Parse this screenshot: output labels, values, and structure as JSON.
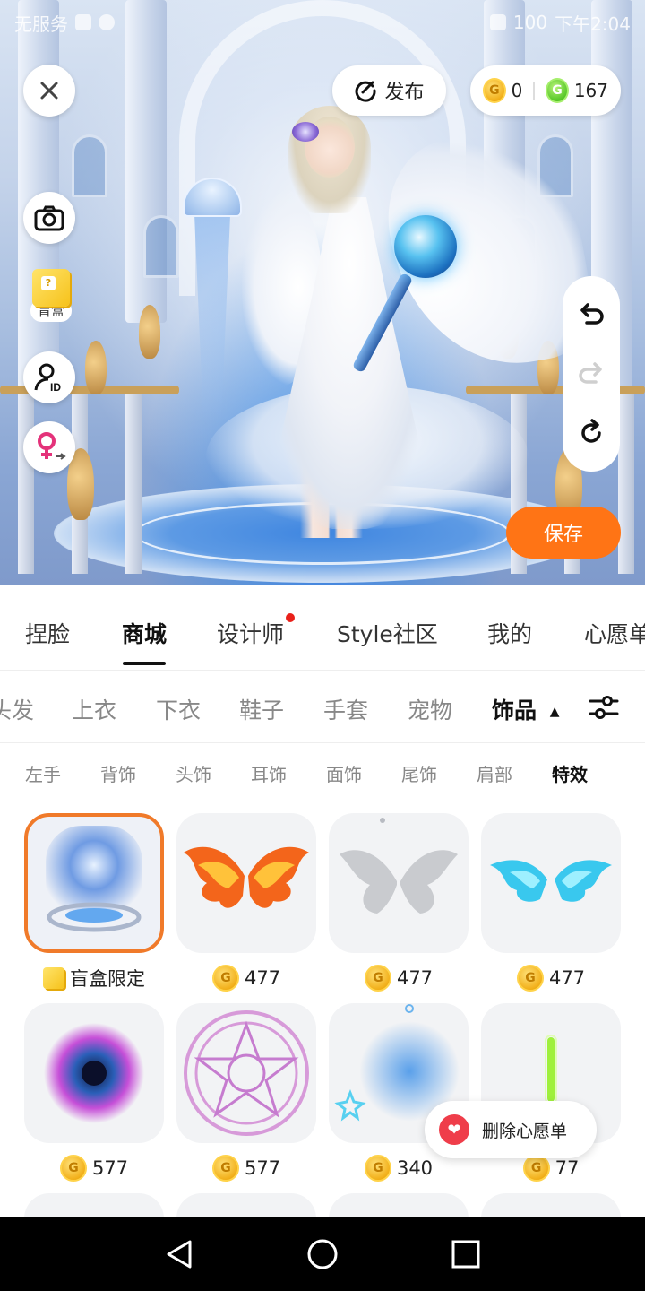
{
  "status_bar": {
    "carrier": "无服务",
    "time": "下午2:04",
    "battery": "100"
  },
  "top_bar": {
    "close_icon": "close-icon",
    "publish_label": "发布",
    "currency_gold": "0",
    "currency_green": "167"
  },
  "side_tools": {
    "camera_icon": "camera-icon",
    "blindbox_label": "盲盒",
    "profile_icon": "profile-id-icon",
    "gender_icon": "female-swap-icon"
  },
  "history": {
    "undo_icon": "undo-icon",
    "redo_icon": "redo-icon",
    "reset_icon": "refresh-icon"
  },
  "save_label": "保存",
  "main_tabs": [
    {
      "label": "捏脸"
    },
    {
      "label": "商城",
      "active": true
    },
    {
      "label": "设计师",
      "dot": true
    },
    {
      "label": "Style社区"
    },
    {
      "label": "我的"
    },
    {
      "label": "心愿单"
    }
  ],
  "categories": [
    {
      "label": "头发"
    },
    {
      "label": "上衣"
    },
    {
      "label": "下衣"
    },
    {
      "label": "鞋子"
    },
    {
      "label": "手套"
    },
    {
      "label": "宠物"
    },
    {
      "label": "饰品",
      "active": true
    }
  ],
  "subcategories": [
    {
      "label": "左手"
    },
    {
      "label": "背饰"
    },
    {
      "label": "头饰"
    },
    {
      "label": "耳饰"
    },
    {
      "label": "面饰"
    },
    {
      "label": "尾饰"
    },
    {
      "label": "肩部"
    },
    {
      "label": "特效",
      "active": true
    }
  ],
  "items": [
    {
      "price": "盲盒限定",
      "currency": "blindbox",
      "selected": true,
      "thumb": "blue-portal-effect"
    },
    {
      "price": "477",
      "currency": "gold",
      "thumb": "flame-wings"
    },
    {
      "price": "477",
      "currency": "gold",
      "thumb": "silver-fairy-wings"
    },
    {
      "price": "477",
      "currency": "gold",
      "thumb": "cyan-crystal-wings"
    },
    {
      "price": "577",
      "currency": "gold",
      "thumb": "galaxy-vortex"
    },
    {
      "price": "577",
      "currency": "gold",
      "thumb": "magic-circle"
    },
    {
      "price": "340",
      "currency": "gold",
      "thumb": "blue-star-glow"
    },
    {
      "price": "77",
      "currency": "gold",
      "thumb": "green-light-stick"
    }
  ],
  "wish_toast": {
    "label": "删除心愿单",
    "icon": "heart-icon"
  },
  "nav": {
    "back": "back-triangle-icon",
    "home": "home-circle-icon",
    "recent": "recent-square-icon"
  },
  "colors": {
    "accent_orange": "#ff7415",
    "selected_border": "#f07a2a",
    "tab_dot": "#e9201a",
    "heart_red": "#ef3d4a"
  }
}
